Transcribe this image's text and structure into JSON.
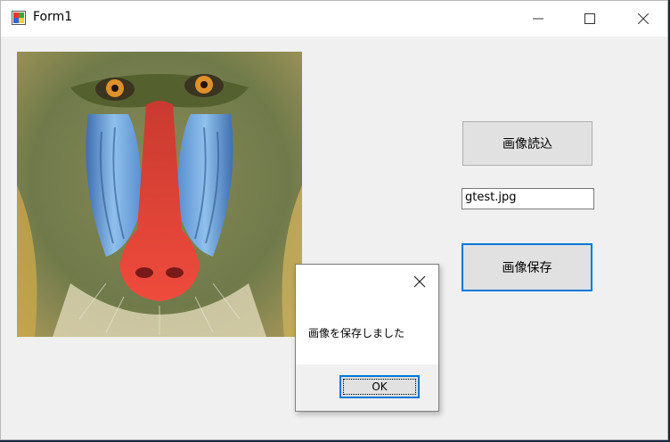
{
  "window": {
    "title": "Form1",
    "icon": "form-app-icon",
    "controls": [
      "minimize-icon",
      "maximize-icon",
      "close-icon"
    ]
  },
  "main": {
    "image_description_icon": "mandrill-photo",
    "load_button_label": "画像読込",
    "filename_value": "gtest.jpg",
    "save_button_label": "画像保存"
  },
  "dialog": {
    "message": "画像を保存しました",
    "ok_label": "OK",
    "close_icon": "close-icon"
  },
  "colors": {
    "window_bg": "#f0f0f0",
    "accent": "#0078d7",
    "button_bg": "#e1e1e1"
  }
}
